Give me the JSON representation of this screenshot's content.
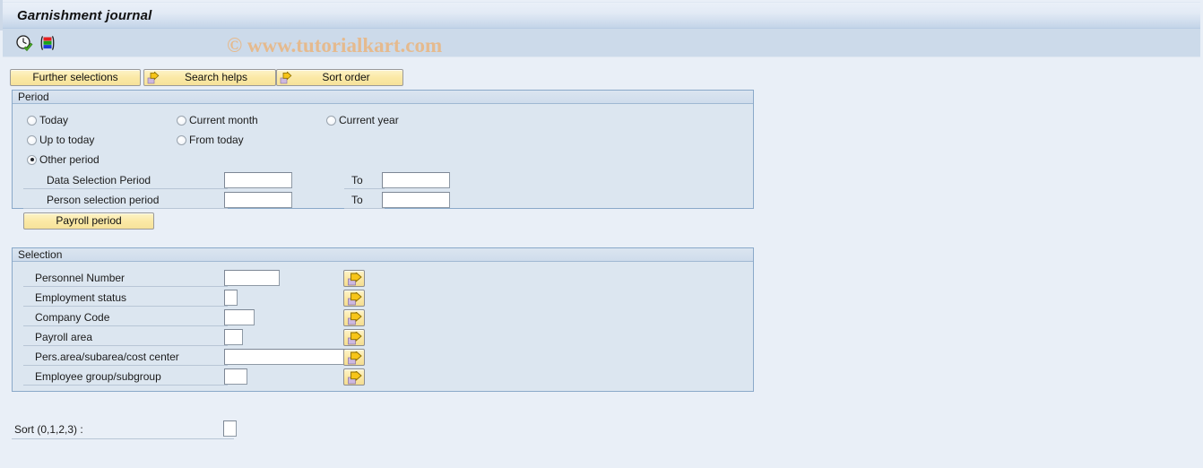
{
  "window": {
    "title": "Garnishment journal",
    "watermark": "© www.tutorialkart.com"
  },
  "toolbar": {
    "items": [
      {
        "name": "execute-icon",
        "tooltip": "Execute"
      },
      {
        "name": "variant-icon",
        "tooltip": "Get Variant"
      }
    ]
  },
  "buttons": {
    "further_selections": "Further selections",
    "search_helps": "Search helps",
    "sort_order": "Sort order"
  },
  "period": {
    "title": "Period",
    "radios": [
      {
        "label": "Today",
        "checked": false
      },
      {
        "label": "Current month",
        "checked": false
      },
      {
        "label": "Current year",
        "checked": false
      },
      {
        "label": "Up to today",
        "checked": false
      },
      {
        "label": "From today",
        "checked": false
      },
      {
        "label": "Other period",
        "checked": true
      }
    ],
    "selected": "Other period",
    "fields": [
      {
        "label": "Data Selection Period",
        "value": "",
        "to_label": "To",
        "to_value": ""
      },
      {
        "label": "Person selection period",
        "value": "",
        "to_label": "To",
        "to_value": ""
      }
    ],
    "payroll_period_button": "Payroll period"
  },
  "selection": {
    "title": "Selection",
    "rows": [
      {
        "label": "Personnel Number",
        "value": ""
      },
      {
        "label": "Employment status",
        "value": ""
      },
      {
        "label": "Company Code",
        "value": ""
      },
      {
        "label": "Payroll area",
        "value": ""
      },
      {
        "label": "Pers.area/subarea/cost center",
        "value": ""
      },
      {
        "label": "Employee group/subgroup",
        "value": ""
      }
    ],
    "multi_select_icon": "multiple-selection-arrow-icon"
  },
  "sort": {
    "label": "Sort (0,1,2,3) :",
    "value": ""
  },
  "colors": {
    "page_background": "#e9eff7",
    "toolbar_background": "#ccdaea",
    "panel_background": "#dce6f0",
    "panel_border": "#8aa9c9",
    "button_yellow": "#fbe9a6",
    "watermark": "#e8b887"
  }
}
